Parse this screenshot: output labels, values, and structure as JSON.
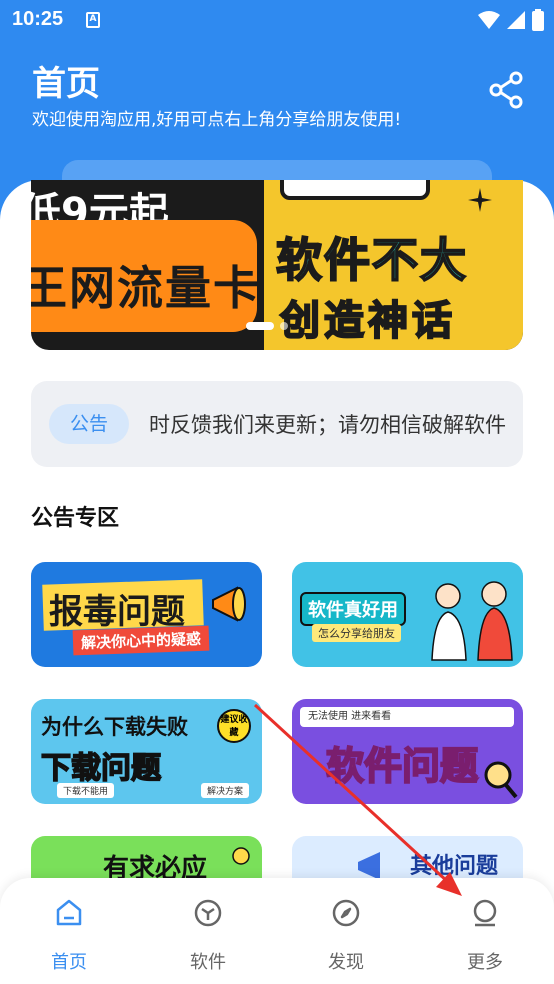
{
  "status_bar": {
    "time": "10:25",
    "app_badge": "A"
  },
  "header": {
    "title": "首页",
    "subtitle": "欢迎使用淘应用,好用可点右上角分享给朋友使用!",
    "share_icon": "share-icon",
    "color": "#2f8af0"
  },
  "banner": {
    "left_line1": "低9元起",
    "left_line2": "王网流量卡",
    "right_line1": "软件不大",
    "right_line2": "创造神话"
  },
  "notice": {
    "tag": "公告",
    "text": "时反馈我们来更新；请勿相信破解软件"
  },
  "section": {
    "title": "公告专区"
  },
  "cards": [
    {
      "title": "报毒问题",
      "subtitle": "解决你心中的疑惑"
    },
    {
      "title": "软件真好用",
      "subtitle": "怎么分享给朋友"
    },
    {
      "title_line1": "为什么下载失败",
      "title_line2": "下载问题",
      "badge": "建议收藏",
      "tag_left": "下载不能用",
      "tag_right": "解决方案"
    },
    {
      "top": "无法使用  进来看看",
      "title": "软件问题"
    },
    {
      "title": "有求必应"
    },
    {
      "title": "其他问题"
    }
  ],
  "nav": [
    {
      "label": "首页",
      "icon": "home-icon",
      "active": true
    },
    {
      "label": "软件",
      "icon": "cube-icon",
      "active": false
    },
    {
      "label": "发现",
      "icon": "compass-icon",
      "active": false
    },
    {
      "label": "更多",
      "icon": "user-icon",
      "active": false
    }
  ],
  "accent_color": "#3b8ff0"
}
